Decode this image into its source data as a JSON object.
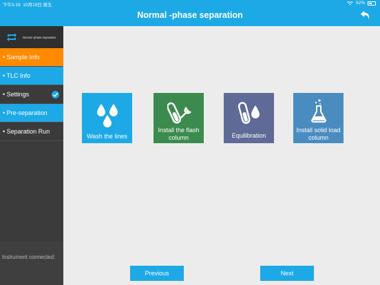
{
  "status_bar": {
    "time": "下午5:19",
    "date": "10月19日 周五",
    "battery": "52%"
  },
  "header": {
    "title": "Normal -phase separation",
    "back_icon": "back-arrow-icon"
  },
  "sidebar": {
    "head_label": "Normal -phase separation",
    "head_icon": "refresh-icon",
    "items": [
      {
        "label": "• Sample Info",
        "state": "active-orange"
      },
      {
        "label": "• TLC Info",
        "state": "blue"
      },
      {
        "label": "• Settings",
        "state": "done"
      },
      {
        "label": "• Pre-separation",
        "state": "blue"
      },
      {
        "label": "• Separation Run",
        "state": "default"
      }
    ],
    "footer": "Instrument connected:"
  },
  "tiles": [
    {
      "label": "Wash the lines",
      "icon": "water-drops-icon",
      "color": "#1da9e6"
    },
    {
      "label": "Install the flash column",
      "icon": "column-wrench-icon",
      "color": "#3b8b4e"
    },
    {
      "label": "Equilibration",
      "icon": "column-drop-icon",
      "color": "#5f6a96"
    },
    {
      "label": "Install solid load column",
      "icon": "flask-icon",
      "color": "#4a8cc0"
    }
  ],
  "buttons": {
    "previous": "Previous",
    "next": "Next"
  },
  "colors": {
    "accent_blue": "#1da9e6",
    "accent_orange": "#ff8a00",
    "sidebar_dark": "#3b3b3b"
  }
}
